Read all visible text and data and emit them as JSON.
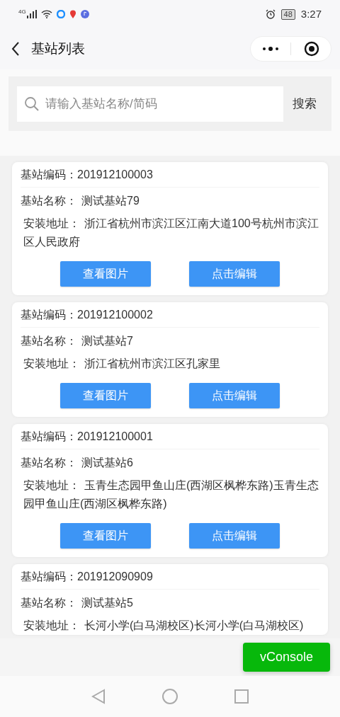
{
  "status_bar": {
    "network": "4G",
    "battery": "48",
    "time": "3:27"
  },
  "header": {
    "title": "基站列表"
  },
  "search": {
    "placeholder": "请输入基站名称/简码",
    "button": "搜索"
  },
  "stations": [
    {
      "code_label": "基站编码：",
      "code": "201912100003",
      "name_label": "基站名称：",
      "name": "测试基站79",
      "address_label": "安装地址：",
      "address": "浙江省杭州市滨江区江南大道100号杭州市滨江区人民政府",
      "buttons": [
        "查看图片",
        "点击编辑"
      ]
    },
    {
      "code_label": "基站编码：",
      "code": "201912100002",
      "name_label": "基站名称：",
      "name": "测试基站7",
      "address_label": "安装地址：",
      "address": "浙江省杭州市滨江区孔家里",
      "buttons": [
        "查看图片",
        "点击编辑"
      ]
    },
    {
      "code_label": "基站编码：",
      "code": "201912100001",
      "name_label": "基站名称：",
      "name": "测试基站6",
      "address_label": "安装地址：",
      "address": "玉青生态园甲鱼山庄(西湖区枫桦东路)玉青生态园甲鱼山庄(西湖区枫桦东路)",
      "buttons": [
        "查看图片",
        "点击编辑"
      ]
    },
    {
      "code_label": "基站编码：",
      "code": "201912090909",
      "name_label": "基站名称：",
      "name": "测试基站5",
      "address_label": "安装地址：",
      "address": "长河小学(白马湖校区)长河小学(白马湖校区)"
    }
  ],
  "vconsole": "vConsole"
}
